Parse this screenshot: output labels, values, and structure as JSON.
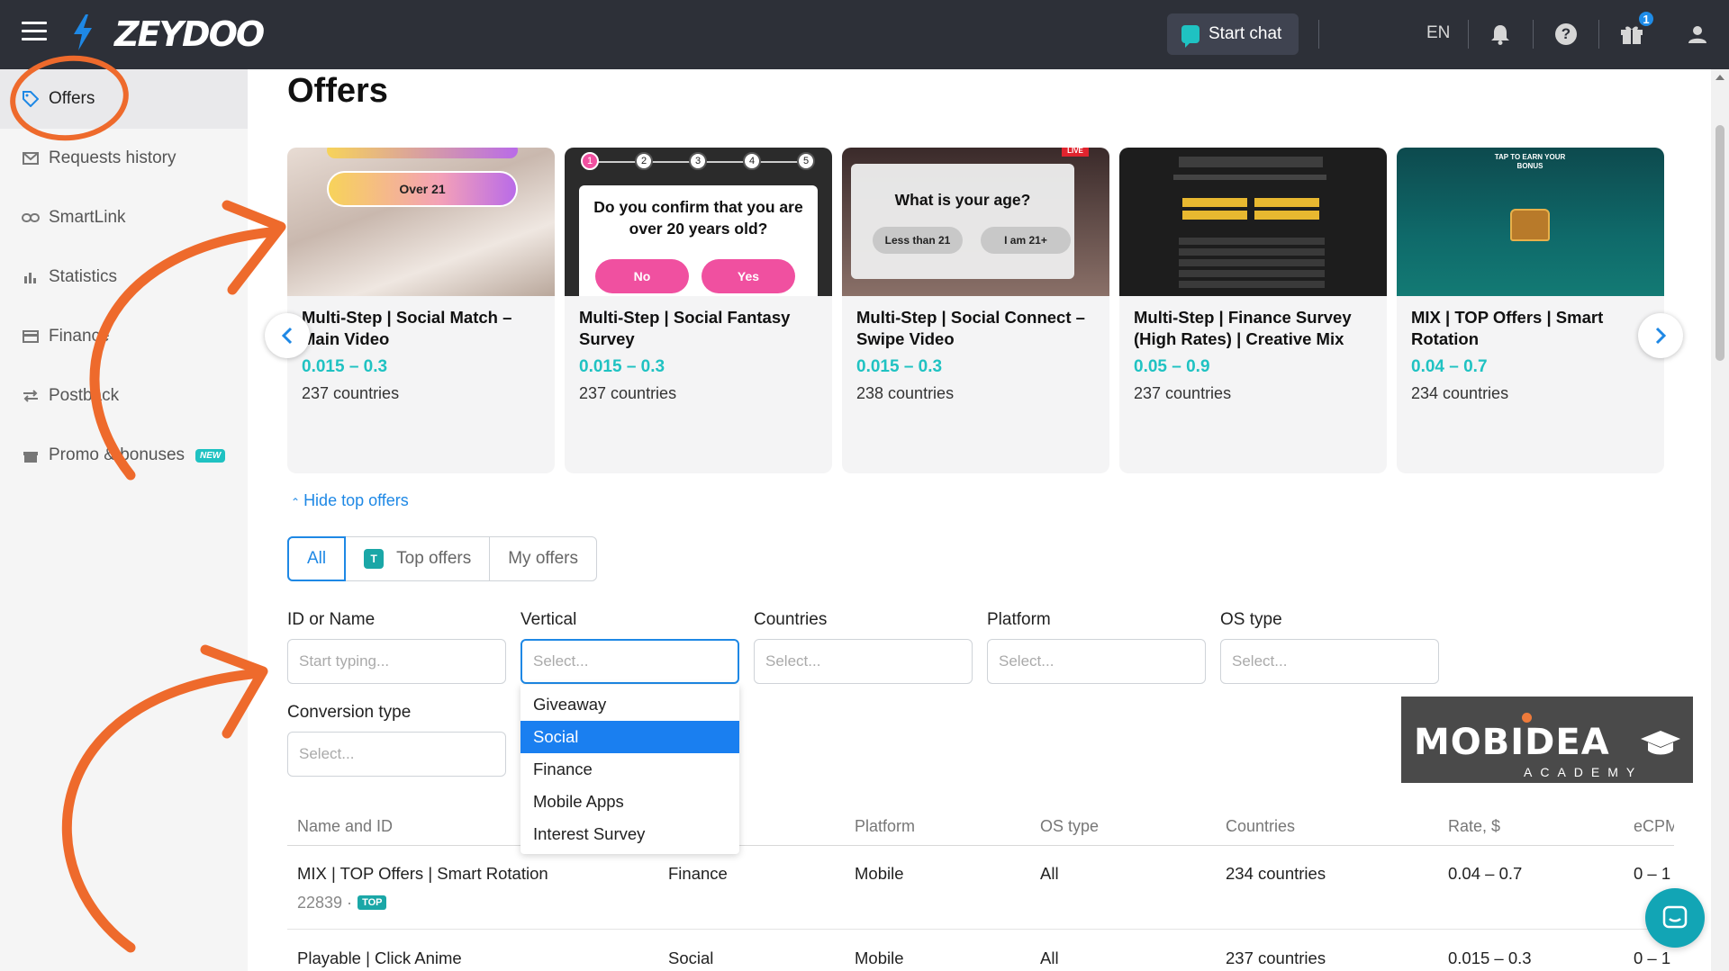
{
  "topbar": {
    "logo": "ZEYDOO",
    "start_chat": "Start chat",
    "language": "EN",
    "gift_count": "1",
    "icons": [
      "menu-icon",
      "bell-icon",
      "help-icon",
      "gift-icon",
      "user-icon"
    ]
  },
  "sidebar": {
    "items": [
      {
        "label": "Offers",
        "icon": "tag-icon",
        "active": true
      },
      {
        "label": "Requests history",
        "icon": "mail-icon"
      },
      {
        "label": "SmartLink",
        "icon": "link-icon"
      },
      {
        "label": "Statistics",
        "icon": "bar-chart-icon"
      },
      {
        "label": "Finance",
        "icon": "card-icon"
      },
      {
        "label": "Postback",
        "icon": "arrows-icon"
      },
      {
        "label": "Promo & bonuses",
        "icon": "gift-icon",
        "badge": "NEW"
      }
    ]
  },
  "main": {
    "title": "Offers",
    "hide_top_offers": "Hide top offers",
    "top_offers": [
      {
        "name": "Multi-Step | Social Match – Main Video",
        "rate": "0.015 – 0.3",
        "countries": "237 countries",
        "thumb_text": "Over 21"
      },
      {
        "name": "Multi-Step | Social Fantasy Survey",
        "rate": "0.015 – 0.3",
        "countries": "237 countries",
        "thumb_question": "Do you confirm that you are over 20 years old?",
        "thumb_no": "No",
        "thumb_yes": "Yes",
        "steps": [
          "1",
          "2",
          "3",
          "4",
          "5"
        ]
      },
      {
        "name": "Multi-Step | Social Connect – Swipe Video",
        "rate": "0.015 – 0.3",
        "countries": "238 countries",
        "thumb_question": "What is your age?",
        "thumb_opt1": "Less than 21",
        "thumb_opt2": "I am 21+",
        "thumb_live": "LIVE"
      },
      {
        "name": "Multi-Step | Finance Survey (High Rates) | Creative Mix",
        "rate": "0.05 – 0.9",
        "countries": "237 countries"
      },
      {
        "name": "MIX | TOP Offers | Smart Rotation",
        "rate": "0.04 – 0.7",
        "countries": "234 countries",
        "thumb_text": "TAP TO EARN YOUR BONUS"
      }
    ],
    "tabs": [
      {
        "label": "All",
        "active": true
      },
      {
        "label": "Top offers",
        "badge": "T"
      },
      {
        "label": "My offers"
      }
    ],
    "filters": {
      "id_name": {
        "label": "ID or Name",
        "placeholder": "Start typing..."
      },
      "vertical": {
        "label": "Vertical",
        "placeholder": "Select..."
      },
      "countries": {
        "label": "Countries",
        "placeholder": "Select..."
      },
      "platform": {
        "label": "Platform",
        "placeholder": "Select..."
      },
      "os_type": {
        "label": "OS type",
        "placeholder": "Select..."
      },
      "conversion_type": {
        "label": "Conversion type",
        "placeholder": "Select..."
      }
    },
    "vertical_options": [
      {
        "label": "Giveaway"
      },
      {
        "label": "Social",
        "selected": true
      },
      {
        "label": "Finance"
      },
      {
        "label": "Mobile Apps"
      },
      {
        "label": "Interest Survey"
      }
    ],
    "table": {
      "headers": {
        "name": "Name and ID",
        "platform": "Platform",
        "os": "OS type",
        "countries": "Countries",
        "rate": "Rate, $",
        "ecpm": "eCPM"
      },
      "rows": [
        {
          "name": "MIX | TOP Offers | Smart Rotation",
          "id": "22839 ·",
          "tag": "TOP",
          "vertical": "Finance",
          "platform": "Mobile",
          "os": "All",
          "countries": "234 countries",
          "rate": "0.04 – 0.7",
          "ecpm": "0 – 1"
        },
        {
          "name": "Playable | Click Anime",
          "vertical": "Social",
          "platform": "Mobile",
          "os": "All",
          "countries": "237 countries",
          "rate": "0.015 – 0.3",
          "ecpm": "0 – 1"
        }
      ]
    }
  },
  "watermark": {
    "brand": "MOBIDEA",
    "sub": "ACADEMY"
  },
  "colors": {
    "accent": "#1e88e5",
    "teal": "#1fc2c2",
    "topbar": "#2d3038",
    "annotation": "#ee6a2c"
  }
}
